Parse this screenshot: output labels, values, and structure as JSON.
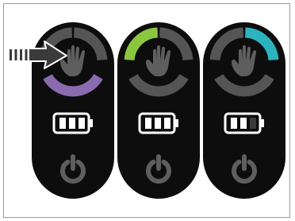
{
  "illustration": {
    "colors": {
      "background": "#ffffff",
      "frame_border": "#9a9a9a",
      "device_body": "#0d0d0d",
      "ring_inactive": "#555555",
      "hand_icon": "#5e5e5e",
      "power_icon": "#5e5e5e",
      "battery_fill": "#ffffff",
      "battery_dark_bar": "#3a3a3a",
      "arrow": "#3a3a3a"
    },
    "pointer": {
      "icon": "arrow-right-icon",
      "style": "striped-tail"
    },
    "devices": [
      {
        "id": "left",
        "hand_icon": "hand-icon",
        "power_icon": "power-icon",
        "ring_highlight": "bottom",
        "ring_color": "#8b6bb0",
        "battery_icon": "battery-icon",
        "battery_bars_full": 3,
        "battery_bars_total": 3
      },
      {
        "id": "middle",
        "hand_icon": "hand-icon",
        "power_icon": "power-icon",
        "ring_highlight": "top-left",
        "ring_color": "#8cc63e",
        "battery_icon": "battery-icon",
        "battery_bars_full": 3,
        "battery_bars_total": 3
      },
      {
        "id": "right",
        "hand_icon": "hand-icon",
        "power_icon": "power-icon",
        "ring_highlight": "top-right",
        "ring_color": "#2bb4c0",
        "battery_icon": "battery-icon",
        "battery_bars_full": 2,
        "battery_bars_total": 3
      }
    ]
  }
}
